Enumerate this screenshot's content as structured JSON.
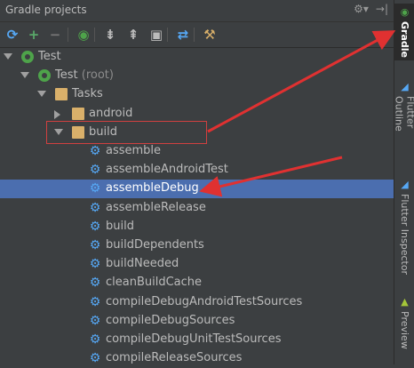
{
  "window": {
    "title": "Gradle projects"
  },
  "title_icons": [
    {
      "icon": "gear-icon",
      "glyph": "⚙▾"
    },
    {
      "icon": "hide-icon",
      "glyph": "→|"
    }
  ],
  "toolbar": {
    "buttons": [
      {
        "icon": "refresh-icon",
        "glyph": "⟳",
        "color": "#56a8f5"
      },
      {
        "icon": "add-icon",
        "glyph": "+",
        "color": "#59a869"
      },
      {
        "icon": "remove-icon",
        "glyph": "−",
        "color": "#777777"
      },
      {
        "icon": "run-gradle-task-icon",
        "glyph": "◉",
        "color": "#4ea34a"
      },
      {
        "icon": "expand-all-icon",
        "glyph": "⇟",
        "color": "#bbbbbb"
      },
      {
        "icon": "collapse-all-icon",
        "glyph": "⇞",
        "color": "#bbbbbb"
      },
      {
        "icon": "attach-project-icon",
        "glyph": "▣",
        "color": "#bbbbbb"
      },
      {
        "icon": "toggle-offline-icon",
        "glyph": "⇄",
        "color": "#56a8f5"
      },
      {
        "icon": "settings-icon",
        "glyph": "⚒",
        "color": "#d9b06a"
      }
    ]
  },
  "tree": [
    {
      "label": "Test",
      "suffix": "",
      "depth": 0,
      "arrow": "down",
      "icon": "gradle-icon",
      "selected": false
    },
    {
      "label": "Test",
      "suffix": " (root)",
      "depth": 1,
      "arrow": "down",
      "icon": "gradle-icon",
      "selected": false
    },
    {
      "label": "Tasks",
      "suffix": "",
      "depth": 2,
      "arrow": "down",
      "icon": "folder-icon",
      "selected": false
    },
    {
      "label": "android",
      "suffix": "",
      "depth": 3,
      "arrow": "right",
      "icon": "folder-gear-icon",
      "selected": false
    },
    {
      "label": "build",
      "suffix": "",
      "depth": 3,
      "arrow": "down",
      "icon": "folder-gear-icon",
      "selected": false
    },
    {
      "label": "assemble",
      "suffix": "",
      "depth": 4,
      "arrow": "",
      "icon": "gear-icon",
      "selected": false
    },
    {
      "label": "assembleAndroidTest",
      "suffix": "",
      "depth": 4,
      "arrow": "",
      "icon": "gear-icon",
      "selected": false
    },
    {
      "label": "assembleDebug",
      "suffix": "",
      "depth": 4,
      "arrow": "",
      "icon": "gear-icon",
      "selected": true
    },
    {
      "label": "assembleRelease",
      "suffix": "",
      "depth": 4,
      "arrow": "",
      "icon": "gear-icon",
      "selected": false
    },
    {
      "label": "build",
      "suffix": "",
      "depth": 4,
      "arrow": "",
      "icon": "gear-icon",
      "selected": false
    },
    {
      "label": "buildDependents",
      "suffix": "",
      "depth": 4,
      "arrow": "",
      "icon": "gear-icon",
      "selected": false
    },
    {
      "label": "buildNeeded",
      "suffix": "",
      "depth": 4,
      "arrow": "",
      "icon": "gear-icon",
      "selected": false
    },
    {
      "label": "cleanBuildCache",
      "suffix": "",
      "depth": 4,
      "arrow": "",
      "icon": "gear-icon",
      "selected": false
    },
    {
      "label": "compileDebugAndroidTestSources",
      "suffix": "",
      "depth": 4,
      "arrow": "",
      "icon": "gear-icon",
      "selected": false
    },
    {
      "label": "compileDebugSources",
      "suffix": "",
      "depth": 4,
      "arrow": "",
      "icon": "gear-icon",
      "selected": false
    },
    {
      "label": "compileDebugUnitTestSources",
      "suffix": "",
      "depth": 4,
      "arrow": "",
      "icon": "gear-icon",
      "selected": false
    },
    {
      "label": "compileReleaseSources",
      "suffix": "",
      "depth": 4,
      "arrow": "",
      "icon": "gear-icon",
      "selected": false
    }
  ],
  "sidebar": {
    "tabs": [
      {
        "label": "Gradle",
        "icon": "gradle-icon",
        "active": true
      },
      {
        "label": "Flutter Outline",
        "icon": "flutter-icon",
        "active": false
      },
      {
        "label": "Flutter Inspector",
        "icon": "flutter-icon",
        "active": false
      },
      {
        "label": "Preview",
        "icon": "android-icon",
        "active": false
      }
    ]
  },
  "colors": {
    "background": "#3c3f41",
    "selection": "#4b6eaf",
    "annotation_red": "#e03131",
    "gradle_green": "#4ea34a",
    "gear_blue": "#56a8f5"
  }
}
